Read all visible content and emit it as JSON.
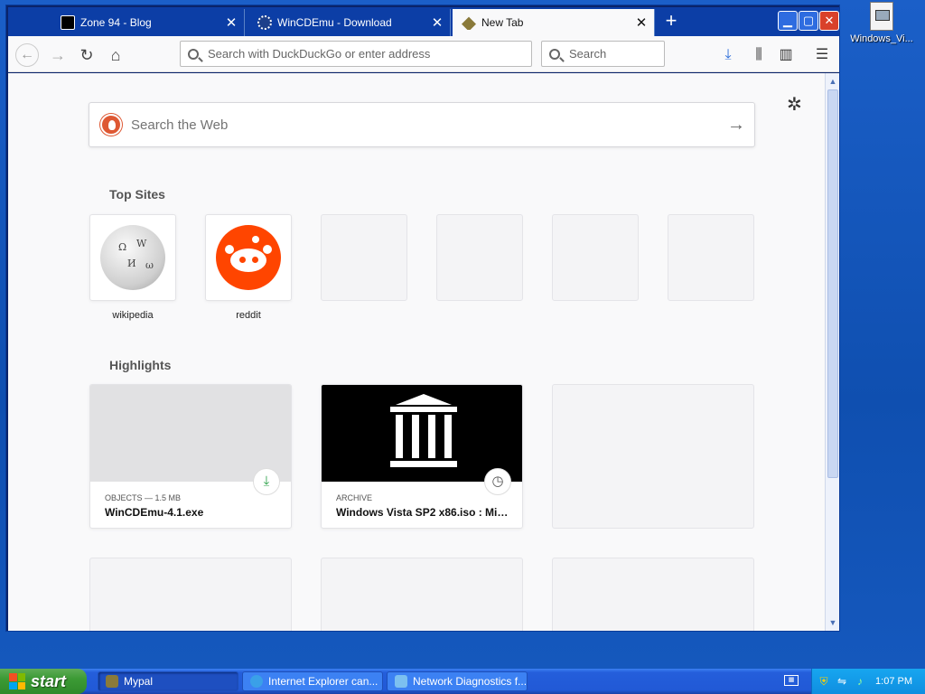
{
  "desktop": {
    "icon_label": "Windows_Vi..."
  },
  "browser": {
    "tabs": [
      {
        "title": "Zone 94 - Blog"
      },
      {
        "title": "WinCDEmu - Download"
      },
      {
        "title": "New Tab"
      }
    ],
    "close_glyph": "✕",
    "new_tab_glyph": "+",
    "url_placeholder": "Search with DuckDuckGo or enter address",
    "search_placeholder": "Search"
  },
  "newtab": {
    "web_search_placeholder": "Search the Web",
    "top_sites_heading": "Top Sites",
    "top_sites": [
      {
        "name": "wikipedia"
      },
      {
        "name": "reddit"
      }
    ],
    "highlights_heading": "Highlights",
    "highlights": [
      {
        "meta": "OBJECTS — 1.5 MB",
        "title": "WinCDEmu-4.1.exe",
        "badge_icon": "download-icon"
      },
      {
        "meta": "ARCHIVE",
        "title": "Windows Vista SP2 x86.iso : Micr...",
        "badge_icon": "clock-icon"
      }
    ]
  },
  "taskbar": {
    "start_label": "start",
    "tasks": [
      {
        "label": "Mypal"
      },
      {
        "label": "Internet Explorer can..."
      },
      {
        "label": "Network Diagnostics f..."
      }
    ],
    "clock": "1:07 PM"
  },
  "colors": {
    "desktop_blue": "#0c51b5",
    "tab_bar": "#0c3ea6",
    "reddit_orange": "#ff4500",
    "download_green": "#2ca24a",
    "close_red": "#d9412a"
  }
}
